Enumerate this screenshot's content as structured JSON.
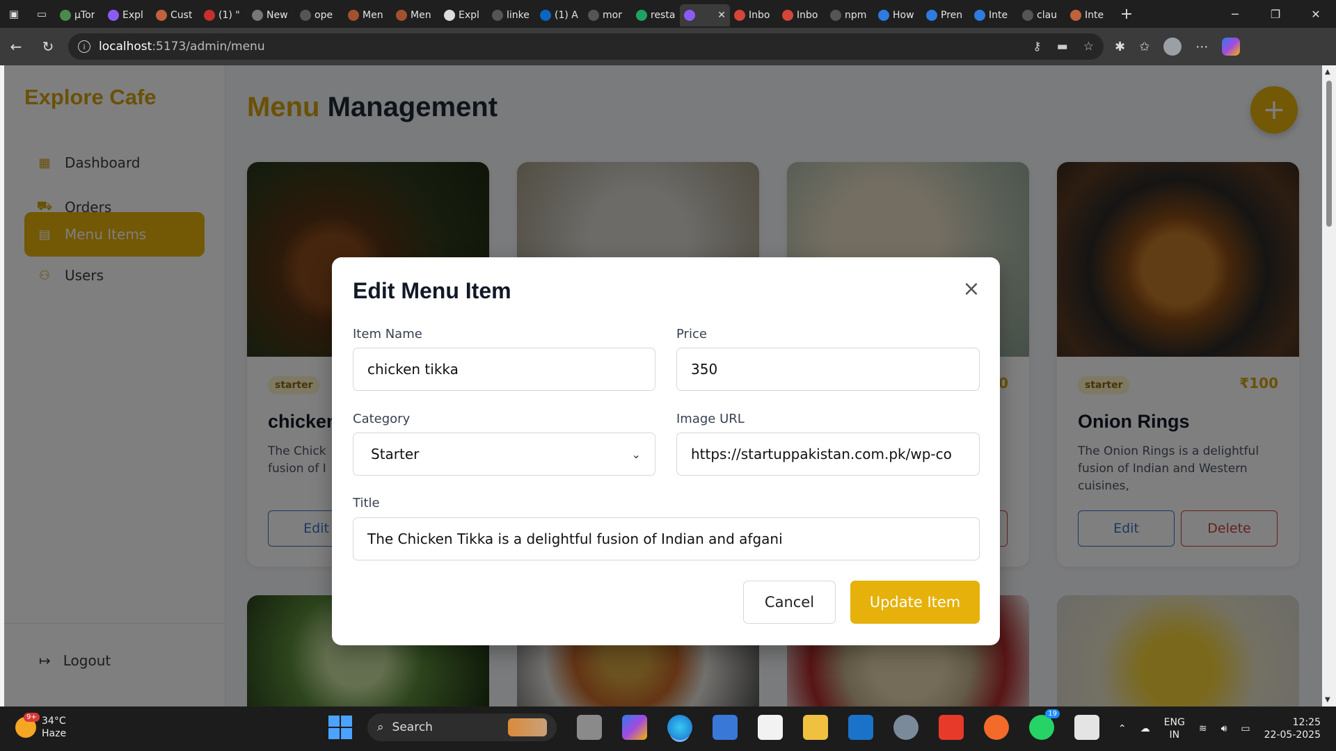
{
  "browser": {
    "tabs": [
      {
        "label": "µTor",
        "color": "#4a8a4a"
      },
      {
        "label": "Expl",
        "color": "#8a5cf5"
      },
      {
        "label": "Cust",
        "color": "#c0623b"
      },
      {
        "label": "(1) \"",
        "color": "#c4302b"
      },
      {
        "label": "New",
        "color": "#777777"
      },
      {
        "label": "ope",
        "color": "#555555"
      },
      {
        "label": "Men",
        "color": "#a0522d"
      },
      {
        "label": "Men",
        "color": "#a0522d"
      },
      {
        "label": "Expl",
        "color": "#dddddd"
      },
      {
        "label": "linke",
        "color": "#555555"
      },
      {
        "label": "(1) A",
        "color": "#0a66c2"
      },
      {
        "label": "mor",
        "color": "#555555"
      },
      {
        "label": "resta",
        "color": "#1ea362"
      },
      {
        "label": "",
        "color": "#8a5cf5",
        "active": true
      },
      {
        "label": "Inbo",
        "color": "#d44638"
      },
      {
        "label": "Inbo",
        "color": "#d44638"
      },
      {
        "label": "npm",
        "color": "#555555"
      },
      {
        "label": "How",
        "color": "#2f7be0"
      },
      {
        "label": "Pren",
        "color": "#2f7be0"
      },
      {
        "label": "Inte",
        "color": "#2f7be0"
      },
      {
        "label": "clau",
        "color": "#555555"
      },
      {
        "label": "Inte",
        "color": "#c0623b"
      }
    ],
    "url_host": "localhost",
    "url_path": ":5173/admin/menu"
  },
  "sidebar": {
    "brand": "Explore Cafe",
    "items": [
      {
        "label": "Dashboard",
        "icon": "dashboard-icon",
        "active": false
      },
      {
        "label": "Orders",
        "icon": "cart-icon",
        "active": false
      },
      {
        "label": "Menu Items",
        "icon": "menu-list-icon",
        "active": true
      },
      {
        "label": "Users",
        "icon": "users-icon",
        "active": false
      }
    ],
    "logout": "Logout"
  },
  "main": {
    "title_accent": "Menu",
    "title_rest": "Management",
    "add_button": "+"
  },
  "cards": [
    {
      "category": "starter",
      "price": "",
      "name": "chicken",
      "desc": "The Chick\nfusion of I",
      "edit": "Edit",
      "delete": ""
    },
    {
      "category": "",
      "price": "",
      "name": "",
      "desc": "",
      "edit": "",
      "delete": ""
    },
    {
      "category": "",
      "price": "0",
      "name": "",
      "desc": "",
      "edit": "",
      "delete": ""
    },
    {
      "category": "starter",
      "price": "₹100",
      "name": "Onion Rings",
      "desc": "The Onion Rings is a delightful fusion of Indian and Western cuisines,",
      "edit": "Edit",
      "delete": "Delete"
    }
  ],
  "modal": {
    "title": "Edit Menu Item",
    "close": "×",
    "labels": {
      "name": "Item Name",
      "price": "Price",
      "category": "Category",
      "image": "Image URL",
      "title": "Title"
    },
    "values": {
      "name": "chicken tikka",
      "price": "350",
      "category": "Starter",
      "image": "https://startuppakistan.com.pk/wp-co",
      "title": "The Chicken Tikka is a delightful fusion of Indian and afgani"
    },
    "cancel": "Cancel",
    "update": "Update Item"
  },
  "taskbar": {
    "weather_temp": "34°C",
    "weather_desc": "Haze",
    "weather_badge": "9+",
    "search": "Search",
    "lang_1": "ENG",
    "lang_2": "IN",
    "time": "12:25",
    "date": "22-05-2025",
    "whatsapp_badge": "19"
  },
  "colors": {
    "accent": "#e6b10a",
    "edit": "#3b6fc2",
    "delete": "#c84040"
  }
}
